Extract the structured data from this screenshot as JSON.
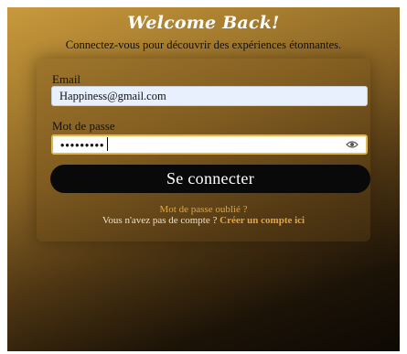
{
  "header": {
    "title": "Welcome Back!",
    "subtitle": "Connectez-vous pour découvrir des expériences étonnantes."
  },
  "form": {
    "email_label": "Email",
    "email_value": "Happiness@gmail.com",
    "password_label": "Mot de passe",
    "password_value": "•••••••••",
    "password_toggle_icon": "eye-icon",
    "submit_label": "Se connecter"
  },
  "footer": {
    "forgot_password": "Mot de passe oublié ?",
    "no_account_text": "Vous n'avez pas de compte ?",
    "signup_link": "Créer un compte ici"
  },
  "colors": {
    "accent": "#e2a53d",
    "button_bg": "#090909",
    "gradient_top": "#c99a3c",
    "gradient_bottom": "#0e0904"
  }
}
